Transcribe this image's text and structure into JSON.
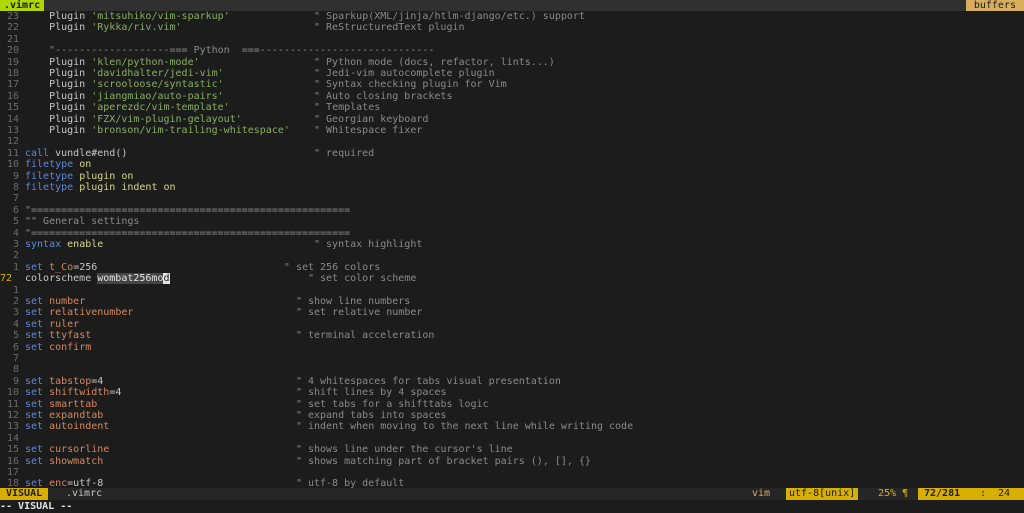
{
  "tabline": {
    "active_tab": ".vimrc",
    "right_label": "buffers"
  },
  "lines": [
    {
      "n": "23",
      "cur": false,
      "parts": [
        {
          "c": "",
          "t": "    "
        },
        {
          "c": "",
          "t": "Plugin "
        },
        {
          "c": "str",
          "t": "'mitsuhiko/vim-sparkup'"
        },
        {
          "c": "",
          "t": "              "
        },
        {
          "c": "cmt",
          "t": "\" Sparkup(XML/jinja/htlm-django/etc.) support"
        }
      ]
    },
    {
      "n": "22",
      "cur": false,
      "parts": [
        {
          "c": "",
          "t": "    Plugin "
        },
        {
          "c": "str",
          "t": "'Rykka/riv.vim'"
        },
        {
          "c": "",
          "t": "                      "
        },
        {
          "c": "cmt",
          "t": "\" ReStructuredText plugin"
        }
      ]
    },
    {
      "n": "21",
      "cur": false,
      "parts": []
    },
    {
      "n": "20",
      "cur": false,
      "parts": [
        {
          "c": "cmt",
          "t": "    \"-------------------=== Python  ===-----------------------------"
        }
      ]
    },
    {
      "n": "19",
      "cur": false,
      "parts": [
        {
          "c": "",
          "t": "    Plugin "
        },
        {
          "c": "str",
          "t": "'klen/python-mode'"
        },
        {
          "c": "",
          "t": "                   "
        },
        {
          "c": "cmt",
          "t": "\" Python mode (docs, refactor, lints...)"
        }
      ]
    },
    {
      "n": "18",
      "cur": false,
      "parts": [
        {
          "c": "",
          "t": "    Plugin "
        },
        {
          "c": "str",
          "t": "'davidhalter/jedi-vim'"
        },
        {
          "c": "",
          "t": "               "
        },
        {
          "c": "cmt",
          "t": "\" Jedi-vim autocomplete plugin"
        }
      ]
    },
    {
      "n": "17",
      "cur": false,
      "parts": [
        {
          "c": "",
          "t": "    Plugin "
        },
        {
          "c": "str",
          "t": "'scrooloose/syntastic'"
        },
        {
          "c": "",
          "t": "               "
        },
        {
          "c": "cmt",
          "t": "\" Syntax checking plugin for Vim"
        }
      ]
    },
    {
      "n": "16",
      "cur": false,
      "parts": [
        {
          "c": "",
          "t": "    Plugin "
        },
        {
          "c": "str",
          "t": "'jiangmiao/auto-pairs'"
        },
        {
          "c": "",
          "t": "               "
        },
        {
          "c": "cmt",
          "t": "\" Auto closing brackets"
        }
      ]
    },
    {
      "n": "15",
      "cur": false,
      "parts": [
        {
          "c": "",
          "t": "    Plugin "
        },
        {
          "c": "str",
          "t": "'aperezdc/vim-template'"
        },
        {
          "c": "",
          "t": "              "
        },
        {
          "c": "cmt",
          "t": "\" Templates"
        }
      ]
    },
    {
      "n": "14",
      "cur": false,
      "parts": [
        {
          "c": "",
          "t": "    Plugin "
        },
        {
          "c": "str",
          "t": "'FZX/vim-plugin-gelayout'"
        },
        {
          "c": "",
          "t": "            "
        },
        {
          "c": "cmt",
          "t": "\" Georgian keyboard"
        }
      ]
    },
    {
      "n": "13",
      "cur": false,
      "parts": [
        {
          "c": "",
          "t": "    Plugin "
        },
        {
          "c": "str",
          "t": "'bronson/vim-trailing-whitespace'"
        },
        {
          "c": "",
          "t": "    "
        },
        {
          "c": "cmt",
          "t": "\" Whitespace fixer"
        }
      ]
    },
    {
      "n": "12",
      "cur": false,
      "parts": []
    },
    {
      "n": "11",
      "cur": false,
      "parts": [
        {
          "c": "kw",
          "t": "call"
        },
        {
          "c": "",
          "t": " vundle#end()                               "
        },
        {
          "c": "cmt",
          "t": "\" required"
        }
      ]
    },
    {
      "n": "10",
      "cur": false,
      "parts": [
        {
          "c": "kw",
          "t": "filetype"
        },
        {
          "c": "",
          "t": " "
        },
        {
          "c": "val",
          "t": "on"
        }
      ]
    },
    {
      "n": "9",
      "cur": false,
      "parts": [
        {
          "c": "kw",
          "t": "filetype"
        },
        {
          "c": "",
          "t": " "
        },
        {
          "c": "val",
          "t": "plugin on"
        }
      ]
    },
    {
      "n": "8",
      "cur": false,
      "parts": [
        {
          "c": "kw",
          "t": "filetype"
        },
        {
          "c": "",
          "t": " "
        },
        {
          "c": "val",
          "t": "plugin indent on"
        }
      ]
    },
    {
      "n": "7",
      "cur": false,
      "parts": []
    },
    {
      "n": "6",
      "cur": false,
      "parts": [
        {
          "c": "cmt",
          "t": "\"====================================================="
        }
      ]
    },
    {
      "n": "5",
      "cur": false,
      "parts": [
        {
          "c": "cmt",
          "t": "\"\" General settings"
        }
      ]
    },
    {
      "n": "4",
      "cur": false,
      "parts": [
        {
          "c": "cmt",
          "t": "\"====================================================="
        }
      ]
    },
    {
      "n": "3",
      "cur": false,
      "parts": [
        {
          "c": "kw",
          "t": "syntax"
        },
        {
          "c": "",
          "t": " "
        },
        {
          "c": "val",
          "t": "enable"
        },
        {
          "c": "",
          "t": "                                   "
        },
        {
          "c": "cmt",
          "t": "\" syntax highlight"
        }
      ]
    },
    {
      "n": "2",
      "cur": false,
      "parts": []
    },
    {
      "n": "1",
      "cur": false,
      "parts": [
        {
          "c": "kw",
          "t": "set"
        },
        {
          "c": "",
          "t": " "
        },
        {
          "c": "opt",
          "t": "t_Co"
        },
        {
          "c": "",
          "t": "=256                               "
        },
        {
          "c": "cmt",
          "t": "\" set 256 colors"
        }
      ]
    },
    {
      "n": "72",
      "cur": true,
      "parts": [
        {
          "c": "",
          "t": "colorscheme "
        },
        {
          "c": "sel",
          "t": "wombat256mo"
        },
        {
          "c": "cursor",
          "t": "d"
        },
        {
          "c": "",
          "t": "                       "
        },
        {
          "c": "cmt",
          "t": "\" set color scheme"
        }
      ]
    },
    {
      "n": "1",
      "cur": false,
      "parts": []
    },
    {
      "n": "2",
      "cur": false,
      "parts": [
        {
          "c": "kw",
          "t": "set"
        },
        {
          "c": "",
          "t": " "
        },
        {
          "c": "opt",
          "t": "number"
        },
        {
          "c": "",
          "t": "                                   "
        },
        {
          "c": "cmt",
          "t": "\" show line numbers"
        }
      ]
    },
    {
      "n": "3",
      "cur": false,
      "parts": [
        {
          "c": "kw",
          "t": "set"
        },
        {
          "c": "",
          "t": " "
        },
        {
          "c": "opt",
          "t": "relativenumber"
        },
        {
          "c": "",
          "t": "                           "
        },
        {
          "c": "cmt",
          "t": "\" set relative number"
        }
      ]
    },
    {
      "n": "4",
      "cur": false,
      "parts": [
        {
          "c": "kw",
          "t": "set"
        },
        {
          "c": "",
          "t": " "
        },
        {
          "c": "opt",
          "t": "ruler"
        }
      ]
    },
    {
      "n": "5",
      "cur": false,
      "parts": [
        {
          "c": "kw",
          "t": "set"
        },
        {
          "c": "",
          "t": " "
        },
        {
          "c": "opt",
          "t": "ttyfast"
        },
        {
          "c": "",
          "t": "                                  "
        },
        {
          "c": "cmt",
          "t": "\" terminal acceleration"
        }
      ]
    },
    {
      "n": "6",
      "cur": false,
      "parts": [
        {
          "c": "kw",
          "t": "set"
        },
        {
          "c": "",
          "t": " "
        },
        {
          "c": "opt",
          "t": "confirm"
        }
      ]
    },
    {
      "n": "7",
      "cur": false,
      "parts": []
    },
    {
      "n": "8",
      "cur": false,
      "parts": []
    },
    {
      "n": "9",
      "cur": false,
      "parts": [
        {
          "c": "kw",
          "t": "set"
        },
        {
          "c": "",
          "t": " "
        },
        {
          "c": "opt",
          "t": "tabstop"
        },
        {
          "c": "",
          "t": "=4                                "
        },
        {
          "c": "cmt",
          "t": "\" 4 whitespaces for tabs visual presentation"
        }
      ]
    },
    {
      "n": "10",
      "cur": false,
      "parts": [
        {
          "c": "kw",
          "t": "set"
        },
        {
          "c": "",
          "t": " "
        },
        {
          "c": "opt",
          "t": "shiftwidth"
        },
        {
          "c": "",
          "t": "=4                             "
        },
        {
          "c": "cmt",
          "t": "\" shift lines by 4 spaces"
        }
      ]
    },
    {
      "n": "11",
      "cur": false,
      "parts": [
        {
          "c": "kw",
          "t": "set"
        },
        {
          "c": "",
          "t": " "
        },
        {
          "c": "opt",
          "t": "smarttab"
        },
        {
          "c": "",
          "t": "                                 "
        },
        {
          "c": "cmt",
          "t": "\" set tabs for a shifttabs logic"
        }
      ]
    },
    {
      "n": "12",
      "cur": false,
      "parts": [
        {
          "c": "kw",
          "t": "set"
        },
        {
          "c": "",
          "t": " "
        },
        {
          "c": "opt",
          "t": "expandtab"
        },
        {
          "c": "",
          "t": "                                "
        },
        {
          "c": "cmt",
          "t": "\" expand tabs into spaces"
        }
      ]
    },
    {
      "n": "13",
      "cur": false,
      "parts": [
        {
          "c": "kw",
          "t": "set"
        },
        {
          "c": "",
          "t": " "
        },
        {
          "c": "opt",
          "t": "autoindent"
        },
        {
          "c": "",
          "t": "                               "
        },
        {
          "c": "cmt",
          "t": "\" indent when moving to the next line while writing code"
        }
      ]
    },
    {
      "n": "14",
      "cur": false,
      "parts": []
    },
    {
      "n": "15",
      "cur": false,
      "parts": [
        {
          "c": "kw",
          "t": "set"
        },
        {
          "c": "",
          "t": " "
        },
        {
          "c": "opt",
          "t": "cursorline"
        },
        {
          "c": "",
          "t": "                               "
        },
        {
          "c": "cmt",
          "t": "\" shows line under the cursor's line"
        }
      ]
    },
    {
      "n": "16",
      "cur": false,
      "parts": [
        {
          "c": "kw",
          "t": "set"
        },
        {
          "c": "",
          "t": " "
        },
        {
          "c": "opt",
          "t": "showmatch"
        },
        {
          "c": "",
          "t": "                                "
        },
        {
          "c": "cmt",
          "t": "\" shows matching part of bracket pairs (), [], {}"
        }
      ]
    },
    {
      "n": "17",
      "cur": false,
      "parts": []
    },
    {
      "n": "18",
      "cur": false,
      "parts": [
        {
          "c": "kw",
          "t": "set"
        },
        {
          "c": "",
          "t": " "
        },
        {
          "c": "opt",
          "t": "enc"
        },
        {
          "c": "",
          "t": "=utf-8                                "
        },
        {
          "c": "cmt",
          "t": "\" utf-8 by default"
        }
      ]
    }
  ],
  "statusline": {
    "mode": "VISUAL",
    "file": ".vimrc",
    "filetype": "vim",
    "encoding": "utf-8[unix]",
    "percent": "25% ¶",
    "position": "72/281",
    "column_sep": ":",
    "column": "24"
  },
  "cmdline": "-- VISUAL --",
  "colors": {
    "background": "#1c1c1c",
    "accent": "#d7af00",
    "tab_active": "#afd700",
    "keyword": "#5f87d7",
    "option": "#d7875f",
    "string": "#87af5f",
    "comment": "#8a8a8a"
  }
}
